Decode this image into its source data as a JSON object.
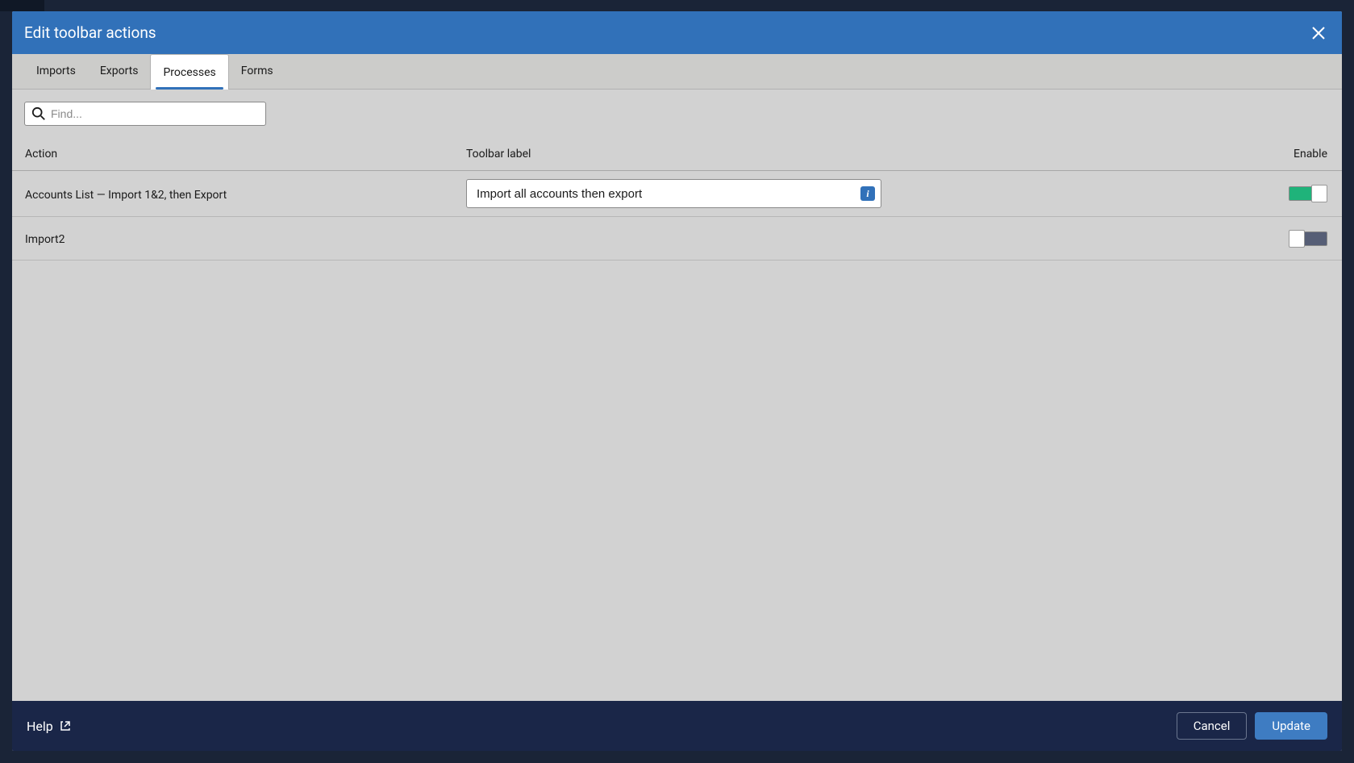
{
  "modal": {
    "title": "Edit toolbar actions"
  },
  "tabs": [
    {
      "label": "Imports",
      "active": false
    },
    {
      "label": "Exports",
      "active": false
    },
    {
      "label": "Processes",
      "active": true
    },
    {
      "label": "Forms",
      "active": false
    }
  ],
  "search": {
    "placeholder": "Find..."
  },
  "columns": {
    "action": "Action",
    "label": "Toolbar label",
    "enable": "Enable"
  },
  "rows": [
    {
      "action": "Accounts List — Import 1&2, then Export",
      "label": "Import all accounts then export",
      "enabled": true,
      "showLabelInput": true
    },
    {
      "action": "Import2",
      "label": "",
      "enabled": false,
      "showLabelInput": false
    }
  ],
  "footer": {
    "help": "Help",
    "cancel": "Cancel",
    "update": "Update"
  },
  "info_icon_text": "i"
}
